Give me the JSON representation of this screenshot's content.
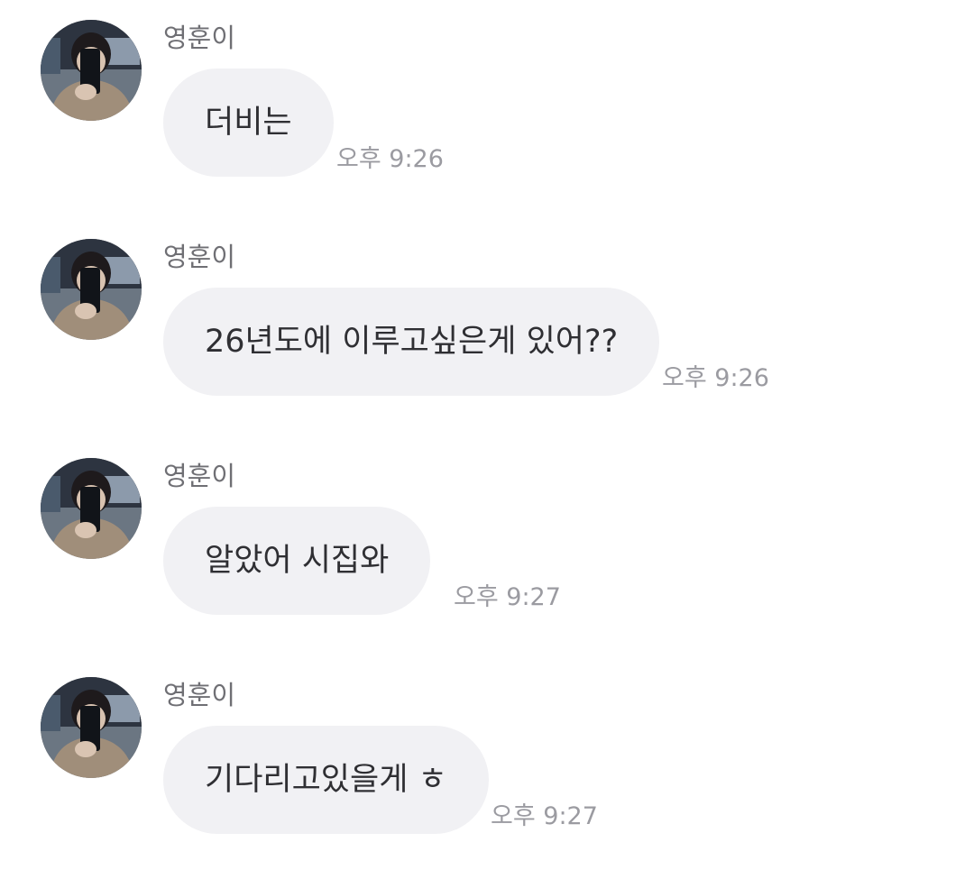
{
  "messages": [
    {
      "sender": "영훈이",
      "text": "더비는",
      "time": "오후 9:26"
    },
    {
      "sender": "영훈이",
      "text": "26년도에 이루고싶은게 있어??",
      "time": "오후 9:26"
    },
    {
      "sender": "영훈이",
      "text": "알았어 시집와",
      "time": "오후 9:27"
    },
    {
      "sender": "영훈이",
      "text": "기다리고있을게 ㅎ",
      "time": "오후 9:27"
    }
  ],
  "avatar": {
    "icon": "profile-photo-icon"
  },
  "colors": {
    "bubble": "#f1f1f4",
    "message_text": "#2f2f33",
    "sender_text": "#6f6f74",
    "time_text": "#9b9ba1"
  }
}
